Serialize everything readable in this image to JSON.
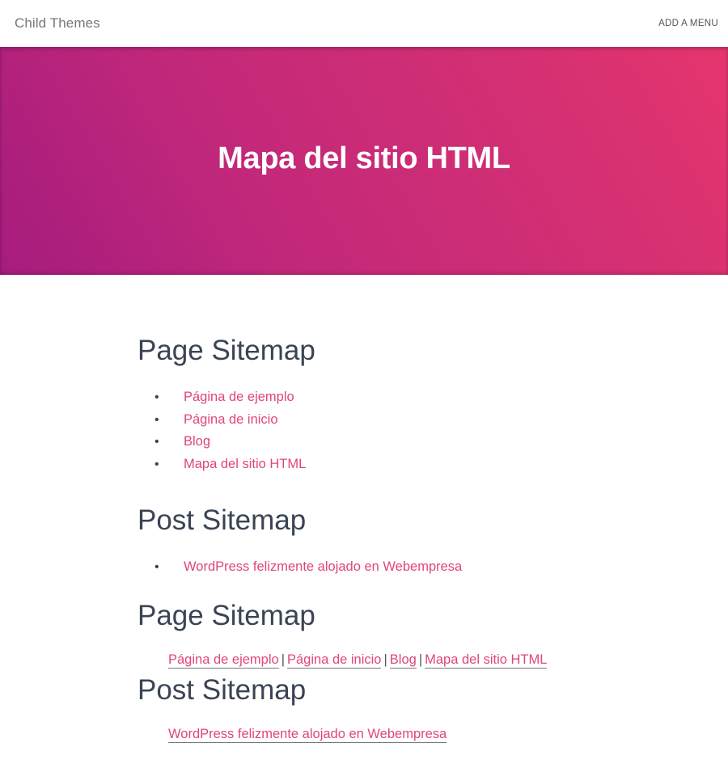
{
  "header": {
    "site_title": "Child Themes",
    "menu_label": "ADD A MENU"
  },
  "hero": {
    "title": "Mapa del sitio HTML"
  },
  "sections": [
    {
      "title": "Page Sitemap",
      "style": "bulleted",
      "items": [
        "Página de ejemplo",
        "Página de inicio",
        "Blog",
        "Mapa del sitio HTML"
      ]
    },
    {
      "title": "Post Sitemap",
      "style": "bulleted",
      "items": [
        "WordPress felizmente alojado en Webempresa"
      ]
    },
    {
      "title": "Page Sitemap",
      "style": "inline",
      "separator": "|",
      "items": [
        "Página de ejemplo",
        "Página de inicio",
        "Blog",
        "Mapa del sitio HTML"
      ]
    },
    {
      "title": "Post Sitemap",
      "style": "inline",
      "items": [
        "WordPress felizmente alojado en Webempresa"
      ]
    }
  ],
  "colors": {
    "link": "#e0457b",
    "heading": "#3a4454",
    "hero_start": "#a61c7e",
    "hero_end": "#e5356e"
  }
}
